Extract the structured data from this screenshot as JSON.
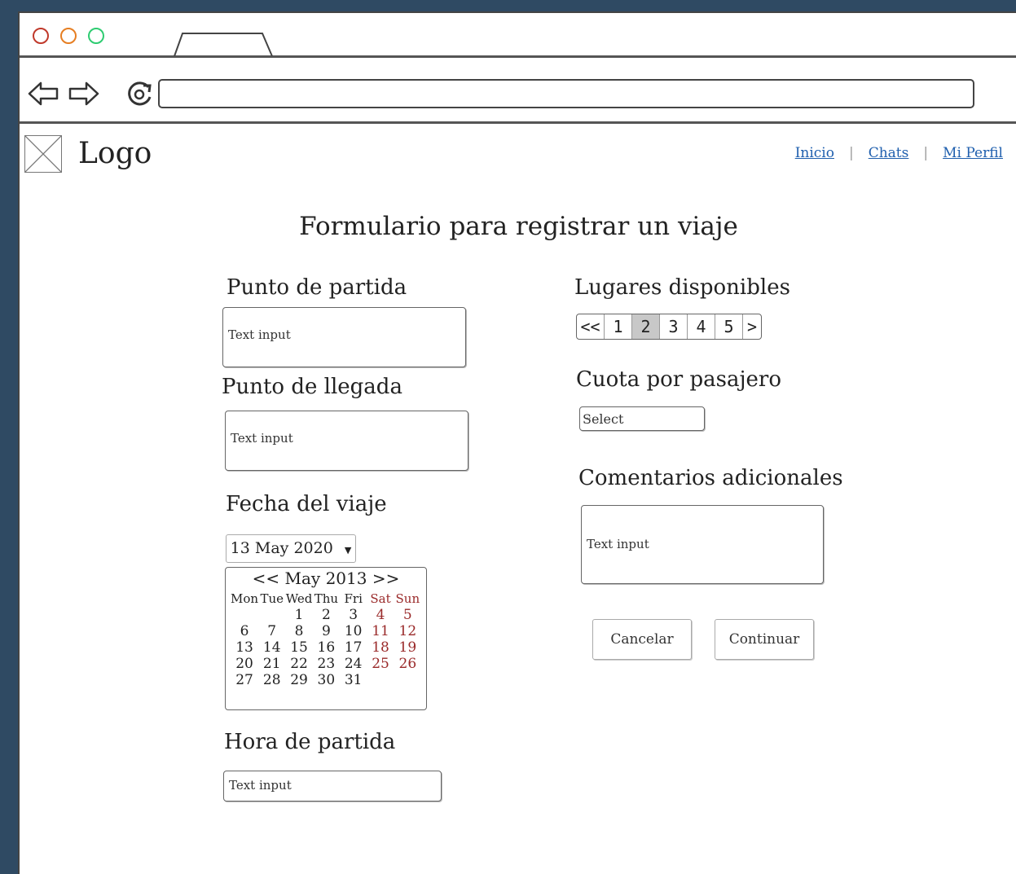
{
  "browser": {
    "traffic_lights": [
      {
        "name": "close",
        "color": "#c0392b"
      },
      {
        "name": "minimize",
        "color": "#e67e22"
      },
      {
        "name": "maximize",
        "color": "#2ecc71"
      }
    ],
    "url": ""
  },
  "header": {
    "logo_text": "Logo",
    "nav_links": [
      "Inicio",
      "Chats",
      "Mi Perfil"
    ]
  },
  "page": {
    "title": "Formulario para registrar un viaje"
  },
  "form": {
    "origin": {
      "label": "Punto de partida",
      "placeholder": "Text input"
    },
    "destination": {
      "label": "Punto de llegada",
      "placeholder": "Text input"
    },
    "date": {
      "label": "Fecha del viaje",
      "selected_value": "13 May 2020",
      "calendar_header": "<< May 2013 >>",
      "weekdays": [
        "Mon",
        "Tue",
        "Wed",
        "Thu",
        "Fri",
        "Sat",
        "Sun"
      ],
      "weeks": [
        [
          "",
          "",
          "1",
          "2",
          "3",
          "4",
          "5"
        ],
        [
          "6",
          "7",
          "8",
          "9",
          "10",
          "11",
          "12"
        ],
        [
          "13",
          "14",
          "15",
          "16",
          "17",
          "18",
          "19"
        ],
        [
          "20",
          "21",
          "22",
          "23",
          "24",
          "25",
          "26"
        ],
        [
          "27",
          "28",
          "29",
          "30",
          "31",
          "",
          ""
        ]
      ]
    },
    "departure_time": {
      "label": "Hora de partida",
      "placeholder": "Text input"
    },
    "seats": {
      "label": "Lugares disponibles",
      "pager": [
        "<<",
        "1",
        "2",
        "3",
        "4",
        "5",
        ">"
      ],
      "active_page": "2"
    },
    "fee": {
      "label": "Cuota por pasajero",
      "select_value": "Select"
    },
    "comments": {
      "label": "Comentarios adicionales",
      "placeholder": "Text input"
    },
    "buttons": {
      "cancel": "Cancelar",
      "continue": "Continuar"
    }
  },
  "colors": {
    "frame_bg": "#2f4a63",
    "link": "#1f5fae",
    "weekend": "#9a2a2a"
  }
}
